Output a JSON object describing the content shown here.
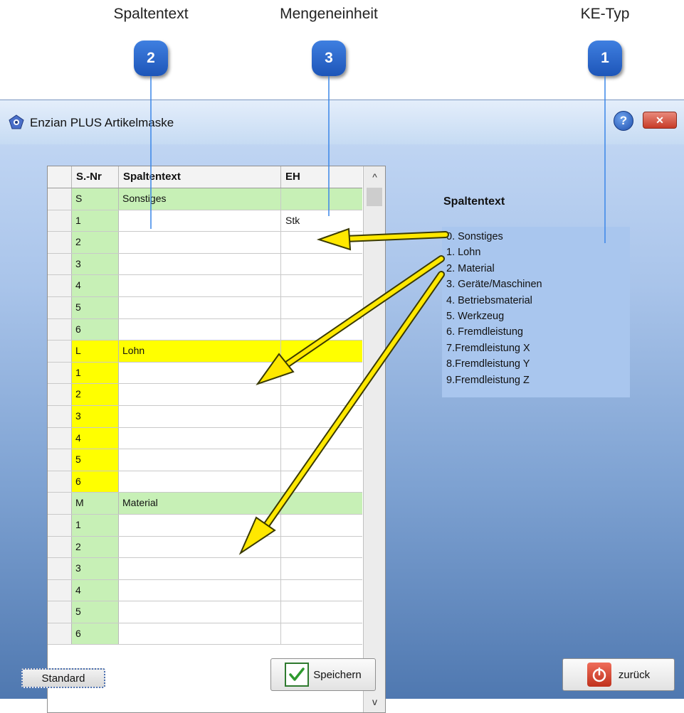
{
  "callouts": [
    {
      "label": "Spaltentext",
      "number": "2"
    },
    {
      "label": "Mengeneinheit",
      "number": "3"
    },
    {
      "label": "KE-Typ",
      "number": "1"
    }
  ],
  "window": {
    "title": "Enzian PLUS Artikelmaske",
    "help_glyph": "?",
    "close_glyph": "✕"
  },
  "grid": {
    "columns": [
      "S.-Nr",
      "Spaltentext",
      "EH"
    ],
    "rows": [
      {
        "nr": "S",
        "text": "Sonstiges",
        "eh": ""
      },
      {
        "nr": "1",
        "text": "",
        "eh": "Stk"
      },
      {
        "nr": "2",
        "text": "",
        "eh": ""
      },
      {
        "nr": "3",
        "text": "",
        "eh": ""
      },
      {
        "nr": "4",
        "text": "",
        "eh": ""
      },
      {
        "nr": "5",
        "text": "",
        "eh": ""
      },
      {
        "nr": "6",
        "text": "",
        "eh": ""
      },
      {
        "nr": "L",
        "text": "Lohn",
        "eh": ""
      },
      {
        "nr": "1",
        "text": "",
        "eh": ""
      },
      {
        "nr": "2",
        "text": "",
        "eh": ""
      },
      {
        "nr": "3",
        "text": "",
        "eh": ""
      },
      {
        "nr": "4",
        "text": "",
        "eh": ""
      },
      {
        "nr": "5",
        "text": "",
        "eh": ""
      },
      {
        "nr": "6",
        "text": "",
        "eh": ""
      },
      {
        "nr": "M",
        "text": "Material",
        "eh": ""
      },
      {
        "nr": "1",
        "text": "",
        "eh": ""
      },
      {
        "nr": "2",
        "text": "",
        "eh": ""
      },
      {
        "nr": "3",
        "text": "",
        "eh": ""
      },
      {
        "nr": "4",
        "text": "",
        "eh": ""
      },
      {
        "nr": "5",
        "text": "",
        "eh": ""
      },
      {
        "nr": "6",
        "text": "",
        "eh": ""
      }
    ],
    "scroll_up_glyph": "^",
    "scroll_down_glyph": "v"
  },
  "legend": {
    "heading": "Spaltentext",
    "items": [
      "0. Sonstiges",
      "1. Lohn",
      "2. Material",
      "3. Geräte/Maschinen",
      "4. Betriebsmaterial",
      "5. Werkzeug",
      "6. Fremdleistung",
      "7.Fremdleistung X",
      "8.Fremdleistung Y",
      "9.Fremdleistung Z"
    ]
  },
  "buttons": {
    "standard": "Standard",
    "save": "Speichern",
    "back": "zurück"
  },
  "colors": {
    "group_green": "#c7f0b6",
    "group_yellow": "#ffff00",
    "callout_blue": "#2a66cc",
    "arrow_yellow": "#ffe800"
  }
}
